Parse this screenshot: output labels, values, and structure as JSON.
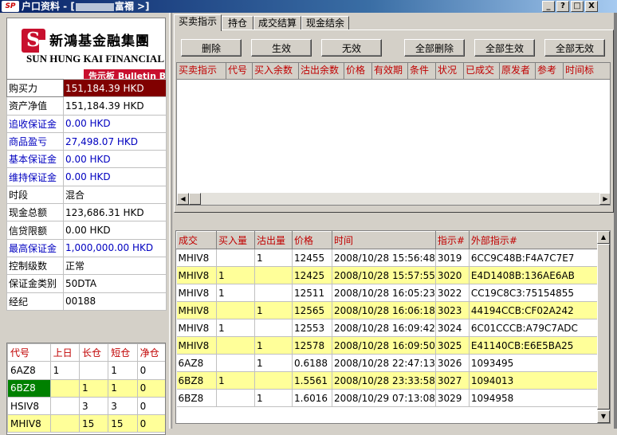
{
  "window": {
    "title_prefix": "户口资料 - [",
    "title_suffix": "富禤   >]",
    "min_label": "_",
    "help_label": "?",
    "max_label": "□",
    "close_label": "X"
  },
  "logo": {
    "name_cn": "新鴻基金融集團",
    "name_en": "SUN HUNG KAI FINANCIAL",
    "bulletin": "告示板 Bulletin Board"
  },
  "account": {
    "rows": [
      {
        "label": "购买力",
        "value": "151,184.39 HKD"
      },
      {
        "label": "资产净值",
        "value": "151,184.39 HKD"
      },
      {
        "label": "追收保证金",
        "value": "0.00 HKD"
      },
      {
        "label": "商品盈亏",
        "value": "27,498.07 HKD"
      },
      {
        "label": "基本保证金",
        "value": "0.00 HKD"
      },
      {
        "label": "维持保证金",
        "value": "0.00 HKD"
      },
      {
        "label": "时段",
        "value": "混合"
      },
      {
        "label": "现金总额",
        "value": "123,686.31 HKD"
      },
      {
        "label": "信贷限额",
        "value": "0.00 HKD"
      },
      {
        "label": "最高保证金",
        "value": "1,000,000.00 HKD"
      },
      {
        "label": "控制级数",
        "value": "正常"
      },
      {
        "label": "保证金类别",
        "value": "50DTA"
      },
      {
        "label": "经纪",
        "value": "00188"
      }
    ]
  },
  "positions": {
    "headers": [
      "代号",
      "上日",
      "长仓",
      "短仓",
      "净仓"
    ],
    "rows": [
      [
        "6AZ8",
        "1",
        "",
        "1",
        "0"
      ],
      [
        "6BZ8",
        "",
        "1",
        "1",
        "0"
      ],
      [
        "HSIV8",
        "",
        "3",
        "3",
        "0"
      ],
      [
        "MHIV8",
        "",
        "15",
        "15",
        "0"
      ]
    ]
  },
  "tabs": [
    "买卖指示",
    "持仓",
    "成交结算",
    "现金结余"
  ],
  "buttons": [
    "删除",
    "生效",
    "无效",
    "全部删除",
    "全部生效",
    "全部无效"
  ],
  "order_headers": [
    "买卖指示",
    "代号",
    "买入余数",
    "沽出余数",
    "价格",
    "有效期",
    "条件",
    "状况",
    "已成交",
    "原发者",
    "参考",
    "时间标"
  ],
  "trades": {
    "headers": [
      "成交",
      "买入量",
      "沽出量",
      "价格",
      "时间",
      "指示#",
      "外部指示#"
    ],
    "rows": [
      [
        "MHIV8",
        "",
        "1",
        "12455",
        "2008/10/28 15:56:48",
        "3019",
        "6CC9C48B:F4A7C7E7"
      ],
      [
        "MHIV8",
        "1",
        "",
        "12425",
        "2008/10/28 15:57:55",
        "3020",
        "E4D1408B:136AE6AB"
      ],
      [
        "MHIV8",
        "1",
        "",
        "12511",
        "2008/10/28 16:05:23",
        "3022",
        "CC19C8C3:75154855"
      ],
      [
        "MHIV8",
        "",
        "1",
        "12565",
        "2008/10/28 16:06:18",
        "3023",
        "44194CCB:CF02A242"
      ],
      [
        "MHIV8",
        "1",
        "",
        "12553",
        "2008/10/28 16:09:42",
        "3024",
        "6C01CCCB:A79C7ADC"
      ],
      [
        "MHIV8",
        "",
        "1",
        "12578",
        "2008/10/28 16:09:50",
        "3025",
        "E41140CB:E6E5BA25"
      ],
      [
        "6AZ8",
        "",
        "1",
        "0.6188",
        "2008/10/28 22:47:13",
        "3026",
        "1093495"
      ],
      [
        "6BZ8",
        "1",
        "",
        "1.5561",
        "2008/10/28 23:33:58",
        "3027",
        "1094013"
      ],
      [
        "6BZ8",
        "",
        "1",
        "1.6016",
        "2008/10/29 07:13:08",
        "3029",
        "1094958"
      ]
    ]
  },
  "colors": {
    "accent_red": "#c00000",
    "highlight_yellow": "#ffff99",
    "selected_dark_red": "#800000",
    "position_green": "#008000"
  }
}
